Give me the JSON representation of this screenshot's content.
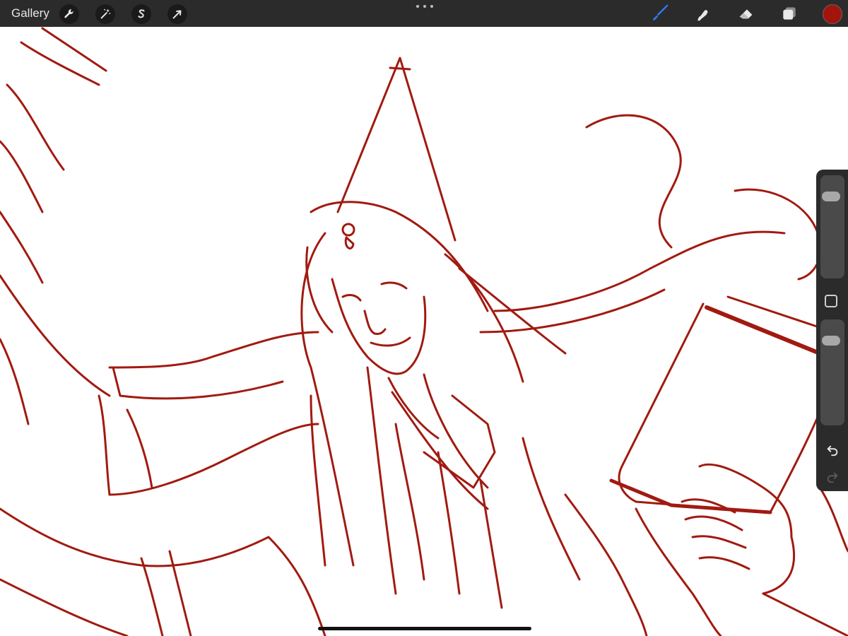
{
  "toolbar": {
    "gallery_label": "Gallery",
    "left_tools": [
      {
        "icon": "wrench-icon"
      },
      {
        "icon": "magic-wand-icon"
      },
      {
        "icon": "selection-s-icon"
      },
      {
        "icon": "transform-arrow-icon"
      }
    ],
    "right_tools": [
      {
        "icon": "brush-icon",
        "active": true
      },
      {
        "icon": "smudge-icon"
      },
      {
        "icon": "eraser-icon"
      },
      {
        "icon": "layers-icon"
      }
    ],
    "current_color": "#a3140d",
    "active_tool_color": "#2f7cf6"
  },
  "sidebar": {
    "brush_size_level": 0.85,
    "opacity_level": 0.85,
    "modifier_icon": "square-modifier-icon",
    "undo_icon": "undo-icon",
    "redo_icon": "redo-icon"
  },
  "canvas": {
    "stroke_color": "#a11a10",
    "background": "#ffffff"
  }
}
